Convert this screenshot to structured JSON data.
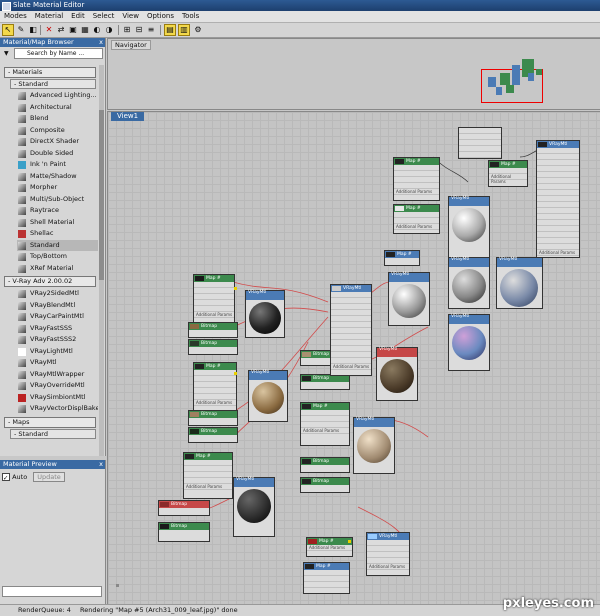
{
  "window": {
    "title": "Slate Material Editor"
  },
  "menu": [
    "Modes",
    "Material",
    "Edit",
    "Select",
    "View",
    "Options",
    "Tools"
  ],
  "browser": {
    "title": "Material/Map Browser",
    "close": "x",
    "search_placeholder": "Search by Name ...",
    "materials_group": "- Materials",
    "standard_group": "- Standard",
    "standard_items": [
      "Advanced Lighting...",
      "Architectural",
      "Blend",
      "Composite",
      "DirectX Shader",
      "Double Sided",
      "Ink 'n Paint",
      "Matte/Shadow",
      "Morpher",
      "Multi/Sub-Object",
      "Raytrace",
      "Shell Material",
      "Shellac",
      "Standard",
      "Top/Bottom",
      "XRef Material"
    ],
    "vray_group": "- V-Ray Adv 2.00.02",
    "vray_items": [
      "VRay2SidedMtl",
      "VRayBlendMtl",
      "VRayCarPaintMtl",
      "VRayFastSSS",
      "VRayFastSSS2",
      "VRayLightMtl",
      "VRayMtl",
      "VRayMtlWrapper",
      "VRayOverrideMtl",
      "VRaySimbiontMtl",
      "VRayVectorDisplBake"
    ],
    "maps_group": "- Maps",
    "maps_standard_group": "- Standard"
  },
  "preview": {
    "title": "Material Preview",
    "close": "x",
    "auto_label": "Auto",
    "update_label": "Update"
  },
  "navigator": {
    "label": "Navigator"
  },
  "view": {
    "tab": "View1"
  },
  "status": {
    "render_queue": "RenderQueue: 4",
    "message": "Rendering \"Map #5 (Arch31_009_leaf.jpg)\" done"
  },
  "watermark": "pxleyes.com",
  "nodes": {
    "map_label": "Map #",
    "bitmap_label": "Bitmap",
    "vraymtl_label": "VRayMtl",
    "additional": "Additional Params"
  }
}
